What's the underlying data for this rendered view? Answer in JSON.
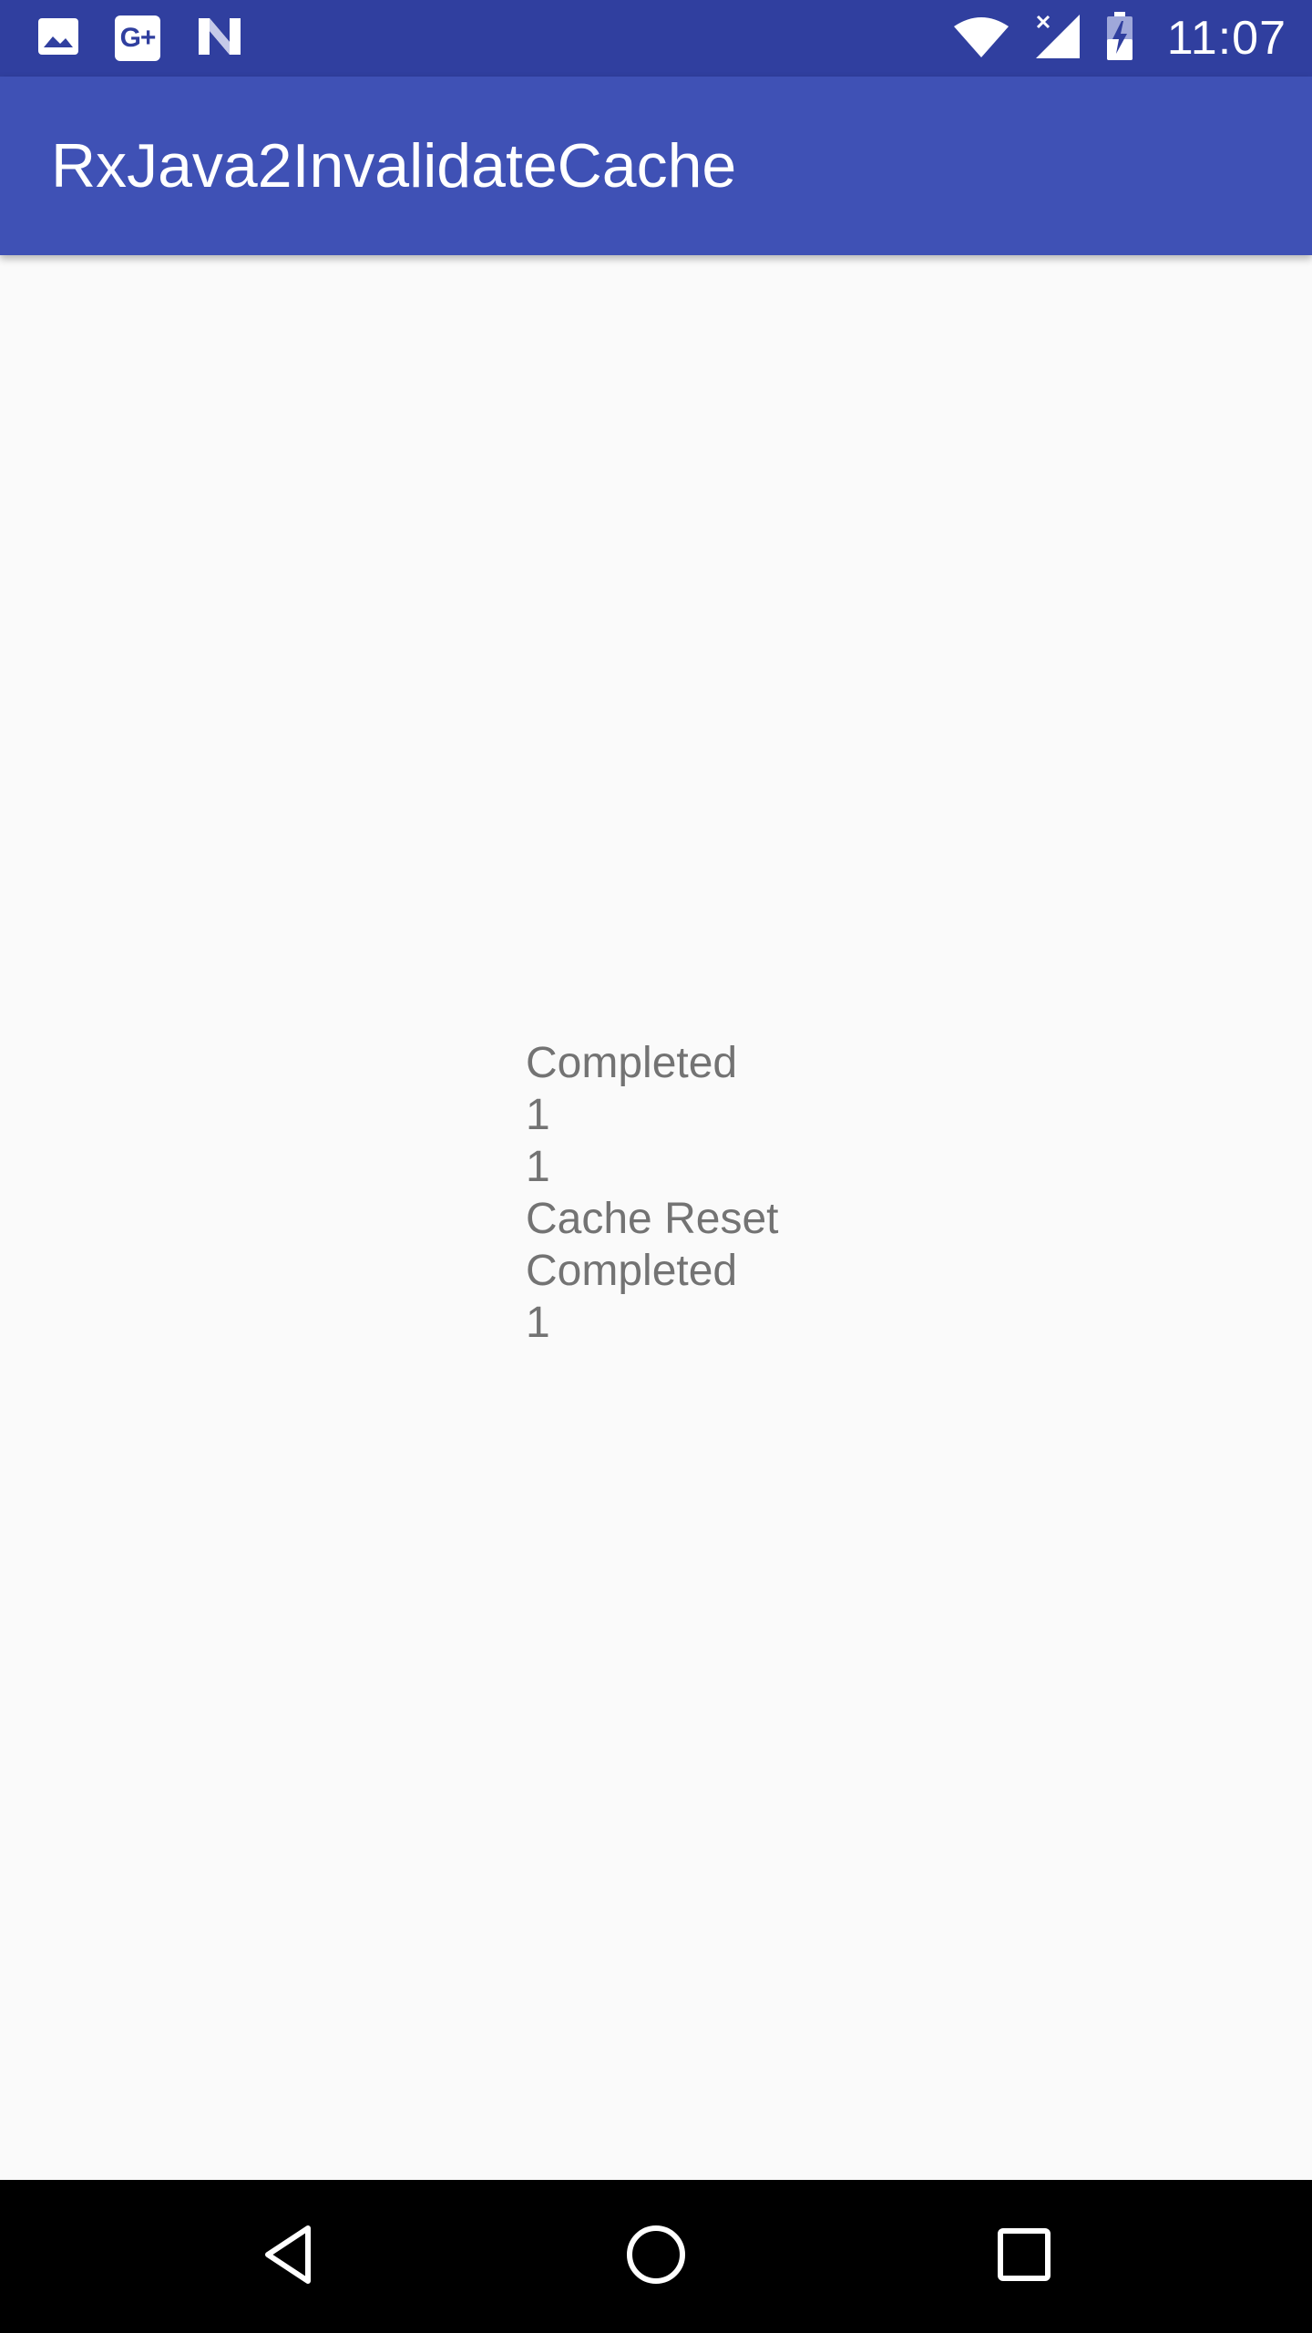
{
  "status_bar": {
    "time": "11:07",
    "left_icons": [
      "image-notification-icon",
      "google-plus-icon",
      "n-preview-icon"
    ],
    "gplus_label": "G+",
    "right_icons": [
      "wifi-icon",
      "cell-signal-icon",
      "battery-charging-icon"
    ],
    "color": "#303f9f"
  },
  "app_bar": {
    "title": "RxJava2InvalidateCache",
    "color": "#3f51b5"
  },
  "content": {
    "lines": [
      "Completed",
      "1",
      "1",
      "Cache Reset",
      "Completed",
      "1"
    ],
    "text_color": "#737373"
  },
  "nav_bar": {
    "buttons": [
      "back-icon",
      "home-icon",
      "recents-icon"
    ]
  }
}
